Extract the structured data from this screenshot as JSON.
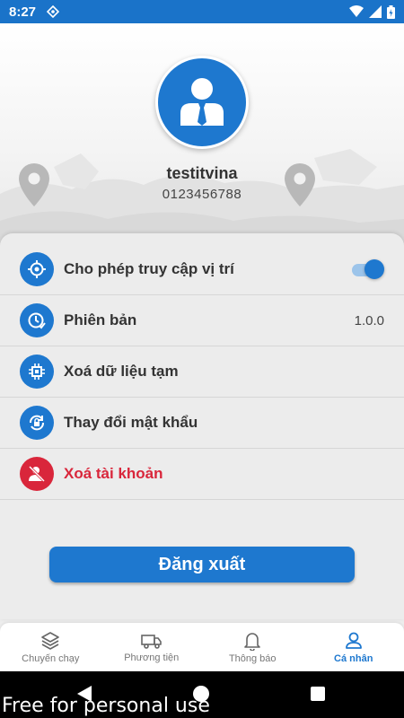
{
  "status_bar": {
    "time": "8:27"
  },
  "profile": {
    "username": "testitvina",
    "phone": "0123456788"
  },
  "settings": [
    {
      "label": "Cho phép truy cập vị trí",
      "icon": "location-crosshair-icon",
      "toggle_on": true
    },
    {
      "label": "Phiên bản",
      "icon": "clock-check-icon",
      "value": "1.0.0"
    },
    {
      "label": "Xoá dữ liệu tạm",
      "icon": "chip-icon"
    },
    {
      "label": "Thay đổi mật khẩu",
      "icon": "lock-refresh-icon"
    },
    {
      "label": "Xoá tài khoản",
      "icon": "user-remove-icon",
      "danger": true
    }
  ],
  "logout_label": "Đăng xuất",
  "bottom_nav": [
    {
      "label": "Chuyến chạy",
      "icon": "layers-icon",
      "active": false
    },
    {
      "label": "Phương tiện",
      "icon": "truck-icon",
      "active": false
    },
    {
      "label": "Thông báo",
      "icon": "bell-icon",
      "active": false
    },
    {
      "label": "Cá nhân",
      "icon": "person-icon",
      "active": true
    }
  ],
  "watermark": "Free for personal use",
  "colors": {
    "primary": "#1e78cf",
    "danger": "#d9263b",
    "status_bar": "#1a73c9"
  }
}
